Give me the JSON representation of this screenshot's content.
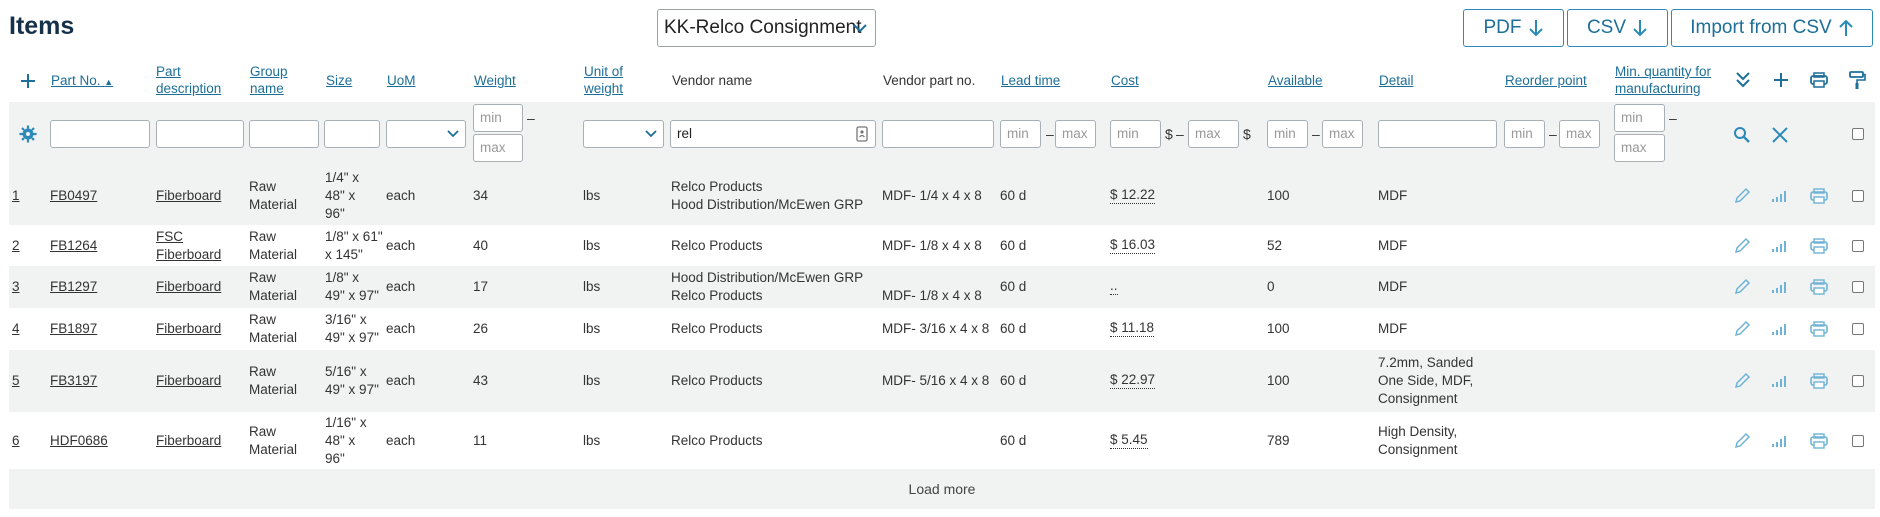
{
  "page": {
    "title": "Items",
    "consignment_select": "KK-Relco Consignment",
    "buttons": {
      "pdf": "PDF",
      "csv": "CSV",
      "import": "Import from CSV"
    }
  },
  "columns": {
    "part_no": "Part No.",
    "part_desc_1": "Part",
    "part_desc_2": "description",
    "group_1": "Group",
    "group_2": "name",
    "size": "Size",
    "uom": "UoM",
    "weight": "Weight",
    "unit_weight_1": "Unit of",
    "unit_weight_2": "weight",
    "vendor_name": "Vendor name",
    "vendor_part": "Vendor part no.",
    "lead_time": "Lead time",
    "cost": "Cost",
    "available": "Available",
    "detail": "Detail",
    "reorder": "Reorder point",
    "min_qty_1": "Min. quantity for",
    "min_qty_2": "manufacturing"
  },
  "filters": {
    "min": "min",
    "max": "max",
    "vendor_value": "rel",
    "dash": "–",
    "dollar": "$"
  },
  "rows": [
    {
      "num": "1",
      "part": "FB0497",
      "desc": [
        "Fiberboard"
      ],
      "group": [
        "Raw",
        "Material"
      ],
      "size": [
        "1/4\" x",
        "48\" x",
        "96\""
      ],
      "uom": "each",
      "weight": "34",
      "unit": "lbs",
      "vendor": [
        "Relco Products",
        "Hood Distribution/McEwen GRP"
      ],
      "vpart": [
        "MDF- 1/4 x 4 x 8"
      ],
      "lead": "60 d",
      "cost": "$ 12.22",
      "avail": "100",
      "detail": [
        "MDF"
      ]
    },
    {
      "num": "2",
      "part": "FB1264",
      "desc": [
        "FSC",
        "Fiberboard"
      ],
      "group": [
        "Raw",
        "Material"
      ],
      "size": [
        "1/8\" x 61\"",
        "x 145\""
      ],
      "uom": "each",
      "weight": "40",
      "unit": "lbs",
      "vendor": [
        "Relco Products"
      ],
      "vpart": [
        "MDF- 1/8 x 4 x 8"
      ],
      "lead": "60 d",
      "cost": "$ 16.03",
      "avail": "52",
      "detail": [
        "MDF"
      ]
    },
    {
      "num": "3",
      "part": "FB1297",
      "desc": [
        "Fiberboard"
      ],
      "group": [
        "Raw",
        "Material"
      ],
      "size": [
        "1/8\" x",
        "49\" x 97\""
      ],
      "uom": "each",
      "weight": "17",
      "unit": "lbs",
      "vendor": [
        "Hood Distribution/McEwen GRP",
        "Relco Products"
      ],
      "vpart": [
        "",
        "MDF- 1/8 x 4 x 8"
      ],
      "lead": "60 d",
      "cost": "..",
      "avail": "0",
      "detail": [
        "MDF"
      ]
    },
    {
      "num": "4",
      "part": "FB1897",
      "desc": [
        "Fiberboard"
      ],
      "group": [
        "Raw",
        "Material"
      ],
      "size": [
        "3/16\" x",
        "49\" x 97\""
      ],
      "uom": "each",
      "weight": "26",
      "unit": "lbs",
      "vendor": [
        "Relco Products"
      ],
      "vpart": [
        "MDF- 3/16 x 4 x 8"
      ],
      "lead": "60 d",
      "cost": "$ 11.18",
      "avail": "100",
      "detail": [
        "MDF"
      ]
    },
    {
      "num": "5",
      "part": "FB3197",
      "desc": [
        "Fiberboard"
      ],
      "group": [
        "Raw",
        "Material"
      ],
      "size": [
        "5/16\" x",
        "49\" x 97\""
      ],
      "uom": "each",
      "weight": "43",
      "unit": "lbs",
      "vendor": [
        "Relco Products"
      ],
      "vpart": [
        "MDF- 5/16 x 4 x 8"
      ],
      "lead": "60 d",
      "cost": "$ 22.97",
      "avail": "100",
      "detail": [
        "7.2mm, Sanded",
        "One Side, MDF,",
        "Consignment"
      ]
    },
    {
      "num": "6",
      "part": "HDF0686",
      "desc": [
        "Fiberboard"
      ],
      "group": [
        "Raw",
        "Material"
      ],
      "size": [
        "1/16\" x",
        "48\" x",
        "96\""
      ],
      "uom": "each",
      "weight": "11",
      "unit": "lbs",
      "vendor": [
        "Relco Products"
      ],
      "vpart": [
        ""
      ],
      "lead": "60 d",
      "cost": "$ 5.45",
      "avail": "789",
      "detail": [
        "High Density,",
        "Consignment"
      ]
    }
  ],
  "footer": {
    "load_more": "Load more"
  },
  "colors": {
    "accent": "#2b8ab8",
    "link": "#1d6f99",
    "band": "#f1f3f3"
  }
}
